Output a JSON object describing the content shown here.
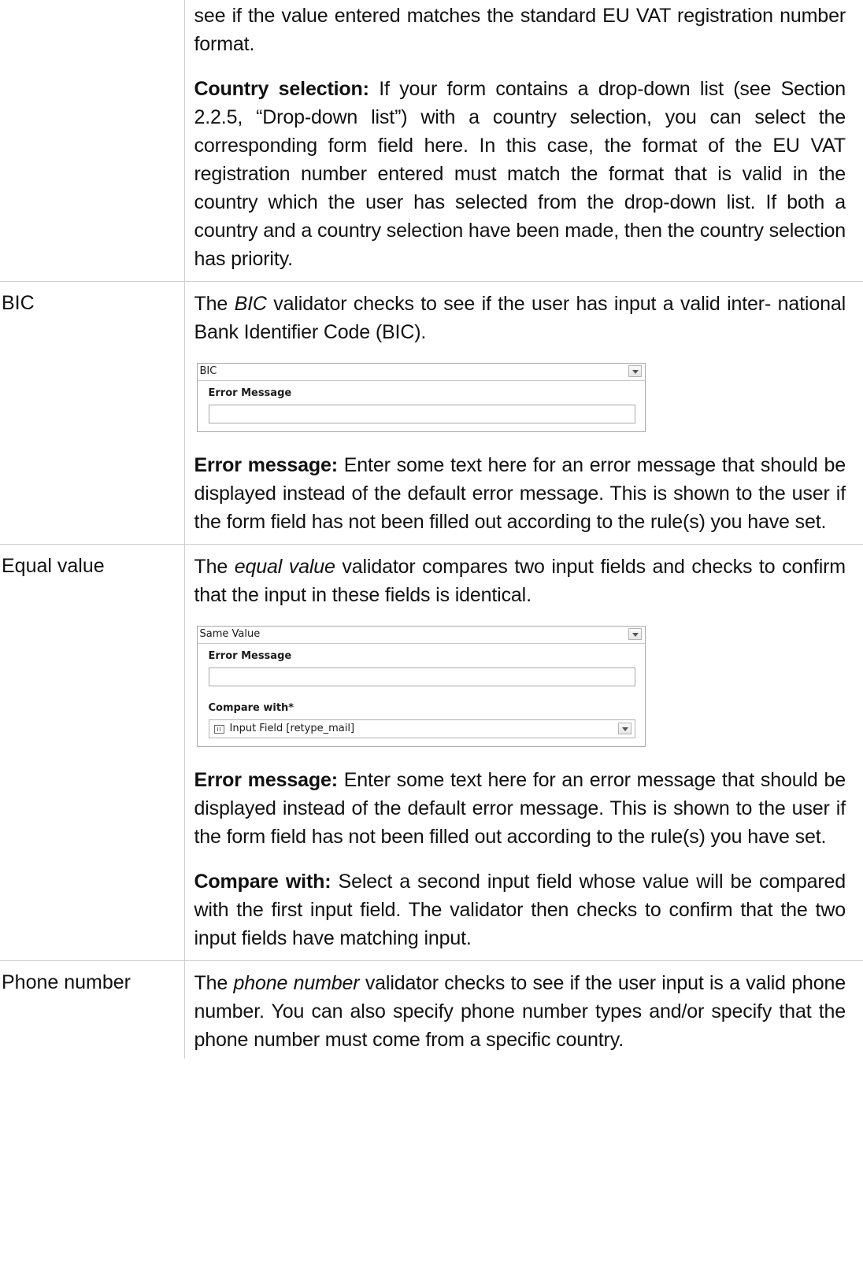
{
  "rows": [
    {
      "name": "",
      "paragraphs": [
        {
          "text": "see if the value entered matches the standard EU VAT registration number format."
        },
        {
          "term": "Country selection:",
          "text": " If your form contains a drop-down list (see Section 2.2.5, “Drop-down list”) with a country selection, you can select the corresponding form field here. In this case, the format of the EU VAT registration number entered must match the format that is valid in the country which the user has selected from the drop-down list. If both a country and a country selection have been made, then the country selection has priority."
        }
      ]
    },
    {
      "name": "BIC",
      "intro": {
        "pre": "The ",
        "em": "BIC",
        "post": " validator checks to see if the user has input a valid inter- national Bank Identifier Code (BIC)."
      },
      "panel": {
        "header": "BIC",
        "error_label": "Error Message",
        "error_value": ""
      },
      "paragraphs": [
        {
          "term": "Error message:",
          "text": " Enter some text here for an error message that should be displayed instead of the default error message. This is shown to the user if the form field has not been filled out according to the rule(s) you have set."
        }
      ]
    },
    {
      "name": "Equal value",
      "intro": {
        "pre": "The ",
        "em": "equal value",
        "post": " validator compares two input fields and checks to confirm that the input in these fields is identical."
      },
      "panel": {
        "header": "Same Value",
        "error_label": "Error Message",
        "error_value": "",
        "compare_label": "Compare with*",
        "compare_value": "Input Field [retype_mail]"
      },
      "paragraphs": [
        {
          "term": "Error message:",
          "text": " Enter some text here for an error message that should be displayed instead of the default error message. This is shown to the user if the form field has not been filled out according to the rule(s) you have set."
        },
        {
          "term": "Compare with:",
          "text": " Select a second input field whose value will be compared with the first input field. The validator then checks to confirm that the two input fields have matching input."
        }
      ]
    },
    {
      "name": "Phone number",
      "intro": {
        "pre": "The ",
        "em": "phone number",
        "post": " validator checks to see if the user input is a valid phone number. You can also specify phone number types and/or specify that the phone number must come from a specific country."
      }
    }
  ]
}
